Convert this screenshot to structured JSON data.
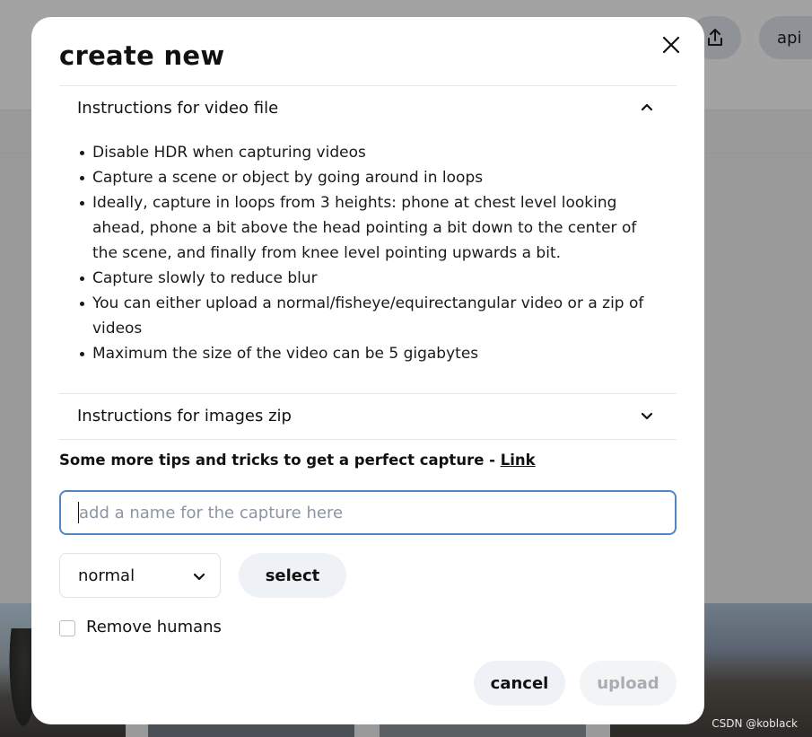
{
  "background": {
    "api_label": "api",
    "share_icon": "upload-icon",
    "watermark": "CSDN @koblack"
  },
  "modal": {
    "title": "create new",
    "close_icon": "close-icon",
    "video_section": {
      "title": "Instructions for video file",
      "expanded": true,
      "items": [
        "Disable HDR when capturing videos",
        "Capture a scene or object by going around in loops",
        "Ideally, capture in loops from 3 heights: phone at chest level looking ahead, phone a bit above the head pointing a bit down to the center of the scene, and finally from knee level pointing upwards a bit.",
        "Capture slowly to reduce blur",
        "You can either upload a normal/fisheye/equirectangular video or a zip of videos",
        "Maximum the size of the video can be 5 gigabytes"
      ]
    },
    "images_section": {
      "title": "Instructions for images zip",
      "expanded": false
    },
    "tips": {
      "text": "Some more tips and tricks to get a perfect capture - ",
      "link_label": "Link"
    },
    "name_input": {
      "placeholder": "add a name for the capture here",
      "value": ""
    },
    "camera_select": {
      "value": "normal"
    },
    "select_button": "select",
    "remove_humans": {
      "label": "Remove humans",
      "checked": false
    },
    "cancel_button": "cancel",
    "upload_button": "upload"
  },
  "colors": {
    "input_border": "#4f86c6",
    "button_bg": "#eef1f5",
    "disabled_text": "#a9adb3"
  }
}
